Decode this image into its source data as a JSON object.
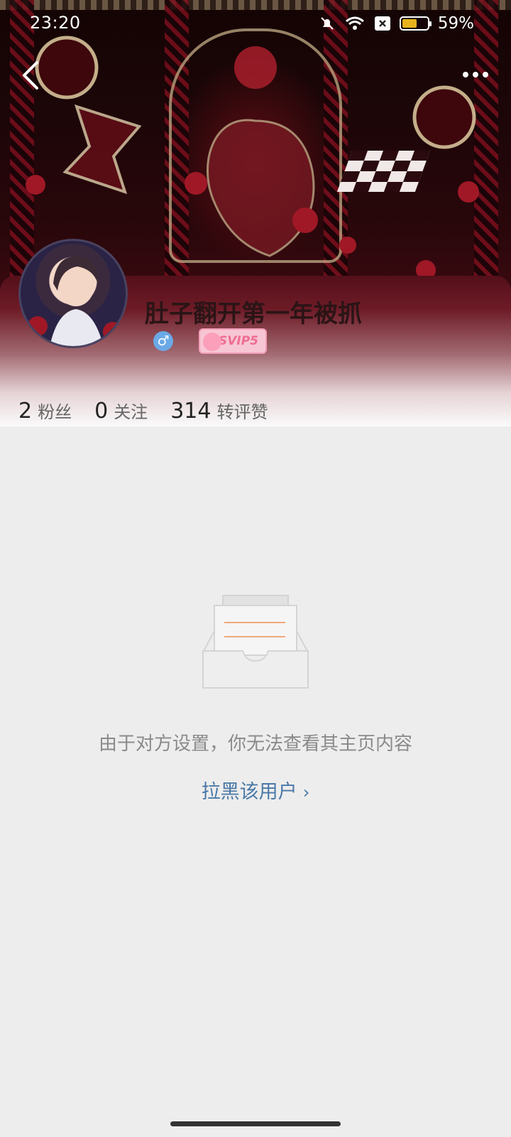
{
  "status_bar": {
    "time": "23:20",
    "battery_text": "59%",
    "battery_level": 0.59,
    "icons": [
      "bell-off-icon",
      "wifi-icon",
      "sim-off-icon",
      "battery-icon"
    ]
  },
  "header": {
    "back_icon": "chevron-left-icon",
    "more_icon": "more-dots-icon"
  },
  "profile": {
    "username": "肚子翻开第一年被抓",
    "gender_symbol": "♂",
    "vip_badge": "SVIP5",
    "stats": [
      {
        "value": "2",
        "label": "粉丝"
      },
      {
        "value": "0",
        "label": "关注"
      },
      {
        "value": "314",
        "label": "转评赞"
      }
    ]
  },
  "empty_state": {
    "illustration": "empty-box-icon",
    "message": "由于对方设置，你无法查看其主页内容",
    "action_label": "拉黑该用户",
    "action_chevron": "›"
  },
  "colors": {
    "accent_link": "#4a78a6",
    "panel_top": "#54101a",
    "background": "#ededed",
    "battery": "#e8b21d",
    "gender": "#6aa9e6",
    "vip": "#ef6d93"
  }
}
